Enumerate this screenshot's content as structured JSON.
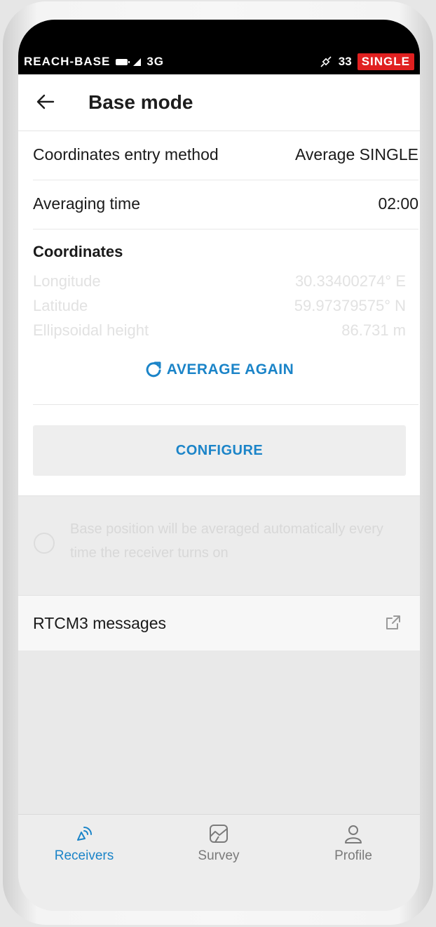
{
  "status_bar": {
    "device_name": "REACH-BASE",
    "network": "3G",
    "satellite_count": "33",
    "solution_status": "SINGLE",
    "solution_color": "#e02020"
  },
  "header": {
    "title": "Base mode",
    "back_icon": "arrow-left-icon"
  },
  "settings": {
    "entry_method_label": "Coordinates entry method",
    "entry_method_value": "Average SINGLE",
    "averaging_time_label": "Averaging time",
    "averaging_time_value": "02:00"
  },
  "coordinates": {
    "title": "Coordinates",
    "rows": [
      {
        "label": "Longitude",
        "value": "30.33400274° E"
      },
      {
        "label": "Latitude",
        "value": "59.97379575° N"
      },
      {
        "label": "Ellipsoidal height",
        "value": "86.731 m"
      }
    ],
    "average_again_label": "AVERAGE AGAIN",
    "average_again_icon": "refresh-icon"
  },
  "configure_label": "CONFIGURE",
  "auto_average_text": "Base position will be averaged automatically every time the receiver turns on",
  "rtcm": {
    "label": "RTCM3 messages",
    "icon": "external-link-icon"
  },
  "bottom_nav": {
    "receivers": "Receivers",
    "survey": "Survey",
    "profile": "Profile"
  },
  "colors": {
    "accent": "#1b84c8"
  }
}
